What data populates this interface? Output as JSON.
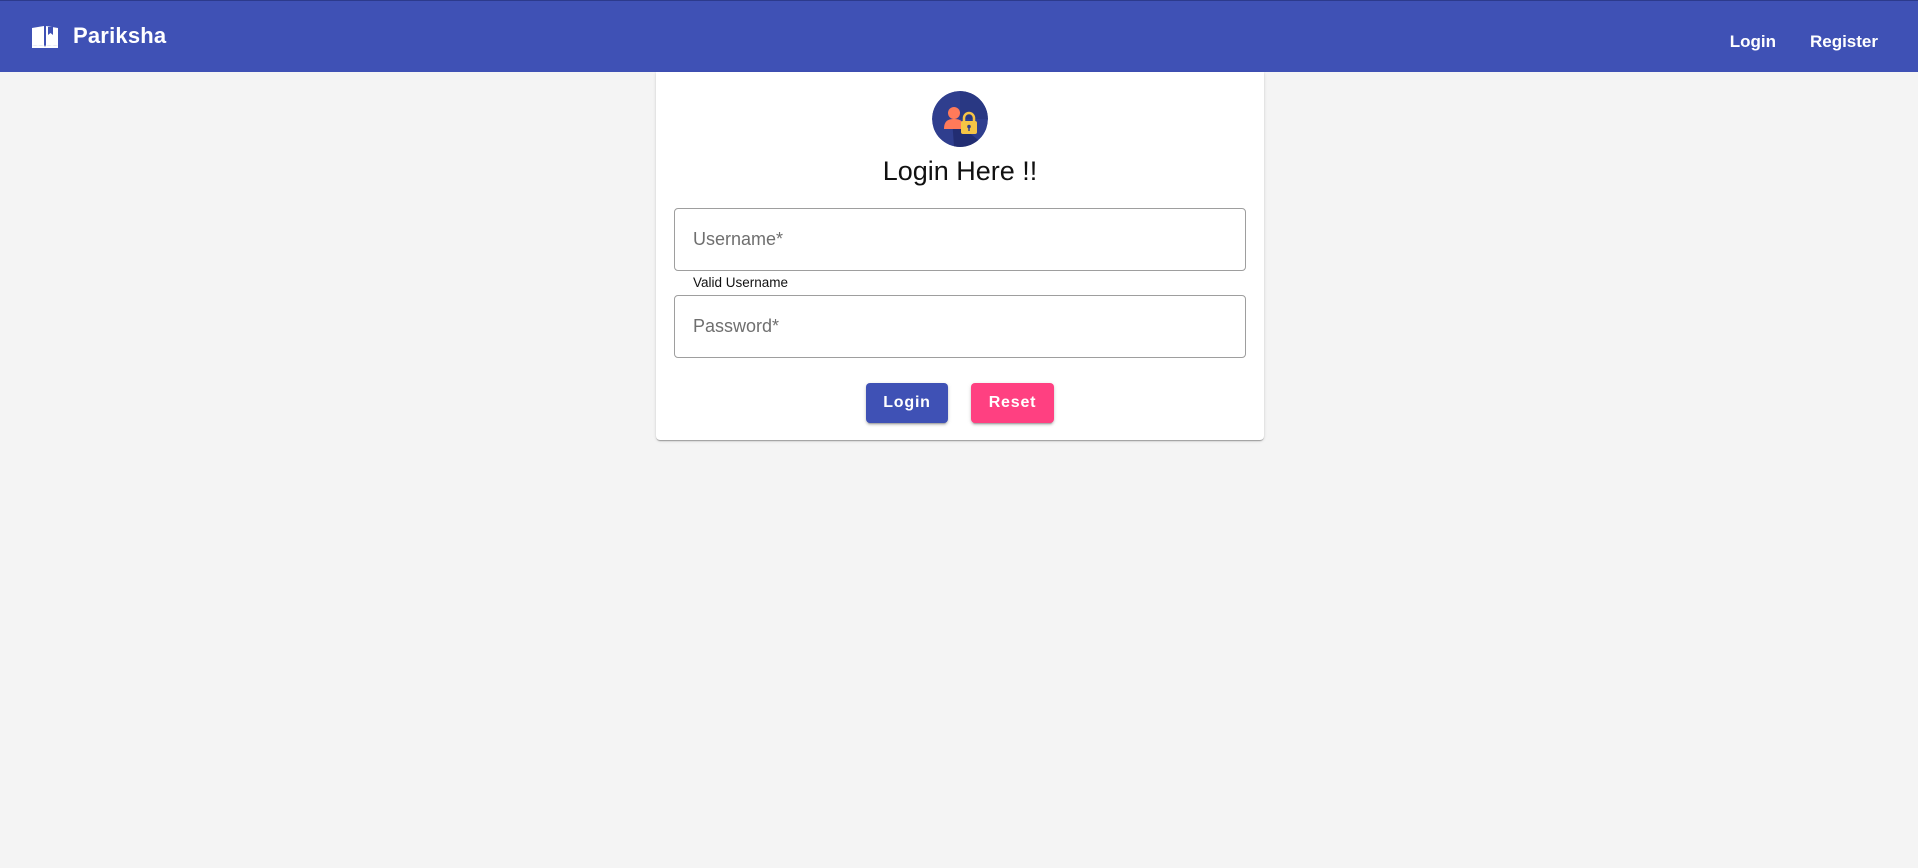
{
  "app": {
    "title": "Pariksha",
    "brand_icon": "open-book-icon"
  },
  "nav": {
    "login_label": "Login",
    "register_label": "Register"
  },
  "login_card": {
    "avatar_icon": "user-lock-icon",
    "title": "Login Here !!",
    "username": {
      "placeholder": "Username*",
      "value": "",
      "hint": "Valid Username"
    },
    "password": {
      "placeholder": "Password*",
      "value": ""
    },
    "login_button_label": "Login",
    "reset_button_label": "Reset"
  },
  "colors": {
    "primary": "#3f51b5",
    "accent": "#ff4081",
    "background": "#f4f4f4",
    "card": "#ffffff"
  }
}
